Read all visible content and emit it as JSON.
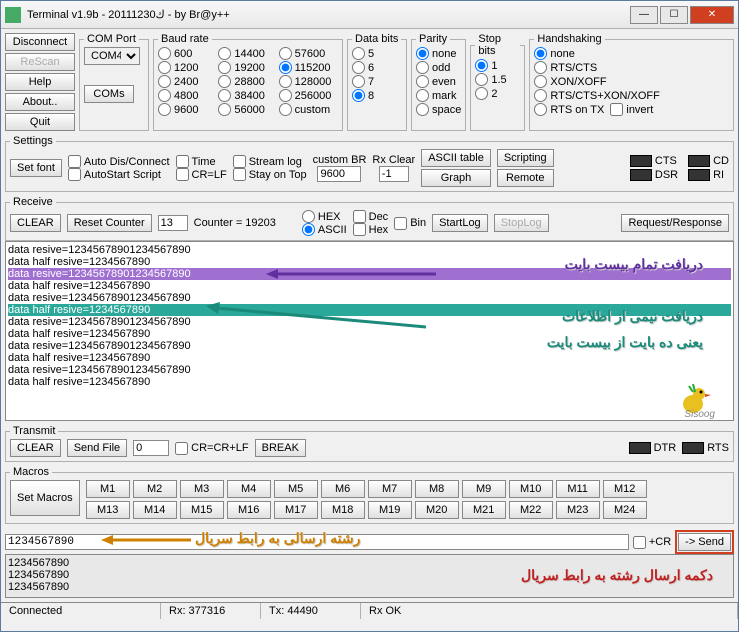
{
  "title": "Terminal v1.9b - 20111230ك - by Br@y++",
  "leftButtons": {
    "disconnect": "Disconnect",
    "rescan": "ReScan",
    "help": "Help",
    "about": "About..",
    "quit": "Quit"
  },
  "comPort": {
    "legend": "COM Port",
    "selected": "COM4",
    "comsBtn": "COMs"
  },
  "baudRate": {
    "legend": "Baud rate",
    "options": [
      "600",
      "14400",
      "57600",
      "1200",
      "19200",
      "115200",
      "2400",
      "28800",
      "128000",
      "4800",
      "38400",
      "256000",
      "9600",
      "56000",
      "custom"
    ],
    "selected": "115200"
  },
  "dataBits": {
    "legend": "Data bits",
    "options": [
      "5",
      "6",
      "7",
      "8"
    ],
    "selected": "8"
  },
  "parity": {
    "legend": "Parity",
    "options": [
      "none",
      "odd",
      "even",
      "mark",
      "space"
    ],
    "selected": "none"
  },
  "stopBits": {
    "legend": "Stop bits",
    "options": [
      "1",
      "1.5",
      "2"
    ],
    "selected": "1"
  },
  "handshaking": {
    "legend": "Handshaking",
    "options": [
      "none",
      "RTS/CTS",
      "XON/XOFF",
      "RTS/CTS+XON/XOFF",
      "RTS on TX"
    ],
    "selected": "none",
    "invert": "invert"
  },
  "settings": {
    "legend": "Settings",
    "setFont": "Set font",
    "autoDis": "Auto Dis/Connect",
    "autoStart": "AutoStart Script",
    "time": "Time",
    "crlf": "CR=LF",
    "streamLog": "Stream log",
    "stayOnTop": "Stay on Top",
    "customBR": "custom BR",
    "customBRVal": "9600",
    "rxClear": "Rx Clear",
    "rxClearVal": "-1",
    "asciiTable": "ASCII table",
    "graph": "Graph",
    "scripting": "Scripting",
    "remote": "Remote"
  },
  "leds": {
    "cts": "CTS",
    "cd": "CD",
    "dsr": "DSR",
    "ri": "RI"
  },
  "receive": {
    "legend": "Receive",
    "clear": "CLEAR",
    "resetCounter": "Reset Counter",
    "counterSel": "13",
    "counterLabel": "Counter = 19203",
    "hex": "HEX",
    "ascii": "ASCII",
    "dec": "Dec",
    "hexChk": "Hex",
    "bin": "Bin",
    "startLog": "StartLog",
    "stopLog": "StopLog",
    "reqResp": "Request/Response",
    "lines": [
      "data resive=12345678901234567890",
      "data half resive=1234567890",
      "data resive=12345678901234567890",
      "data half resive=1234567890",
      "data resive=12345678901234567890",
      "data half resive=1234567890",
      "data resive=12345678901234567890",
      "data half resive=1234567890",
      "data resive=12345678901234567890",
      "data half resive=1234567890",
      "data resive=12345678901234567890",
      "data half resive=1234567890"
    ]
  },
  "annotations": {
    "purple": "دریافت تمام بیست بایت",
    "teal1": "دریافت نیمی از اطلاعات",
    "teal2": "یعنی ده بایت از بیست بایت",
    "orange": "رشته ارسالی به رابط سریال",
    "red": "دکمه ارسال رشته به رابط سریال",
    "sisoog": "Sisoog"
  },
  "transmit": {
    "legend": "Transmit",
    "clear": "CLEAR",
    "sendFile": "Send File",
    "delay": "0",
    "crcrlf": "CR=CR+LF",
    "break": "BREAK",
    "dtr": "DTR",
    "rts": "RTS"
  },
  "macros": {
    "legend": "Macros",
    "setMacros": "Set Macros",
    "row1": [
      "M1",
      "M2",
      "M3",
      "M4",
      "M5",
      "M6",
      "M7",
      "M8",
      "M9",
      "M10",
      "M11",
      "M12"
    ],
    "row2": [
      "M13",
      "M14",
      "M15",
      "M16",
      "M17",
      "M18",
      "M19",
      "M20",
      "M21",
      "M22",
      "M23",
      "M24"
    ]
  },
  "send": {
    "input": "1234567890",
    "cr": "+CR",
    "sendBtn": "-> Send"
  },
  "sendLog": [
    "1234567890",
    "1234567890",
    "1234567890"
  ],
  "status": {
    "connected": "Connected",
    "rx": "Rx: 377316",
    "tx": "Tx: 44490",
    "rxok": "Rx OK"
  }
}
